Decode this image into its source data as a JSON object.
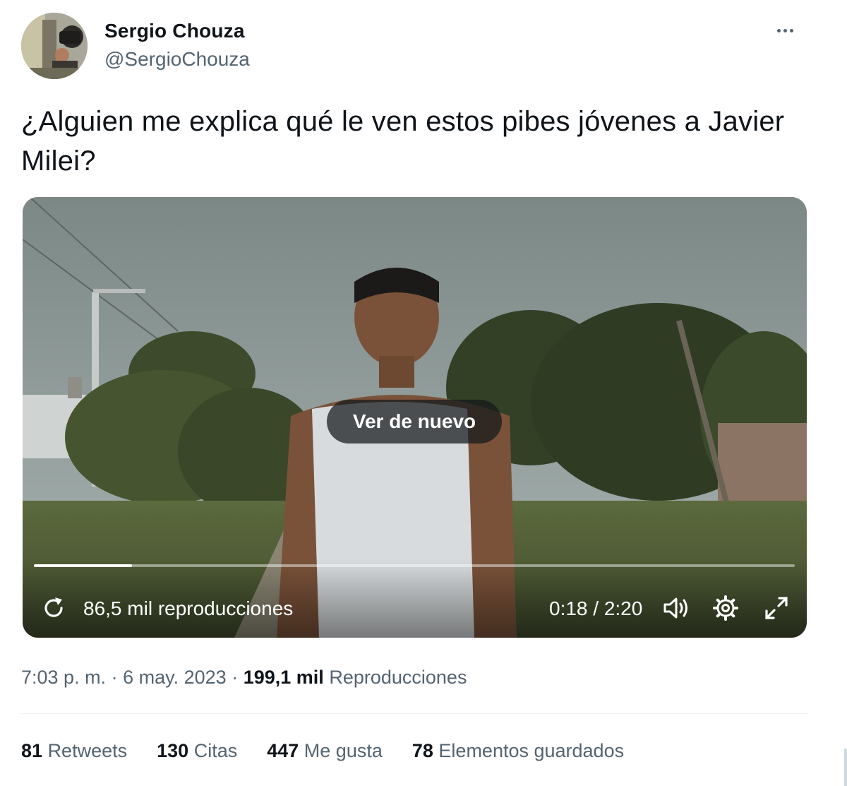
{
  "author": {
    "display_name": "Sergio Chouza",
    "handle": "@SergioChouza",
    "avatar_icon": "avatar-photo"
  },
  "tweet": {
    "text": "¿Alguien me explica qué le ven estos pibes jóvenes a Javier Milei?"
  },
  "video": {
    "replay_label": "Ver de nuevo",
    "views": "86,5 mil reproducciones",
    "time": "0:18 / 2:20",
    "progress_fraction": 0.129,
    "icons": [
      "replay-icon",
      "volume-icon",
      "gear-icon",
      "fullscreen-icon"
    ]
  },
  "meta": {
    "time": "7:03 p. m.",
    "separator": "·",
    "date": "6 may. 2023",
    "views_count": "199,1 mil",
    "views_label": "Reproducciones"
  },
  "stats": [
    {
      "count": "81",
      "label": "Retweets"
    },
    {
      "count": "130",
      "label": "Citas"
    },
    {
      "count": "447",
      "label": "Me gusta"
    },
    {
      "count": "78",
      "label": "Elementos guardados"
    }
  ],
  "colors": {
    "text_primary": "#0f1419",
    "text_secondary": "#536471",
    "divider": "#eff3f4"
  }
}
